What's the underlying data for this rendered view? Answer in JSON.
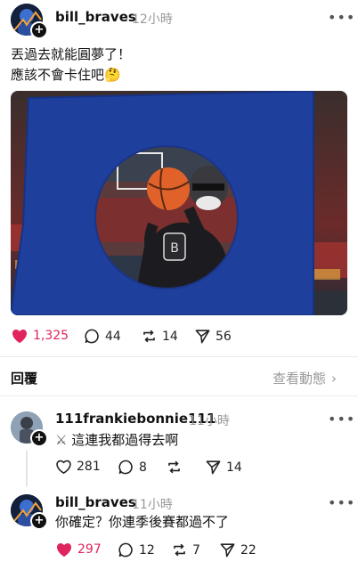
{
  "post": {
    "username": "bill_braves",
    "time": "12小時",
    "line1": "丟過去就能圓夢了！",
    "line2": "應該不會卡住吧",
    "emoji": "🤔",
    "likes": "1,325",
    "comments": "44",
    "reposts": "14",
    "shares": "56"
  },
  "replies_bar": {
    "label": "回覆",
    "activity_link": "查看動態"
  },
  "replies": [
    {
      "username": "111frankiebonnie111",
      "time": "11小時",
      "text": "這連我都過得去啊",
      "emoji": "⚔",
      "likes": "281",
      "comments": "8",
      "shares": "14"
    },
    {
      "username": "bill_braves",
      "time": "11小時",
      "text": "你確定？你連季後賽都過不了",
      "likes": "297",
      "comments": "12",
      "reposts": "7",
      "shares": "22"
    }
  ],
  "colors": {
    "like_active": "#e0245e",
    "panel_blue": "#1f3f9c"
  }
}
